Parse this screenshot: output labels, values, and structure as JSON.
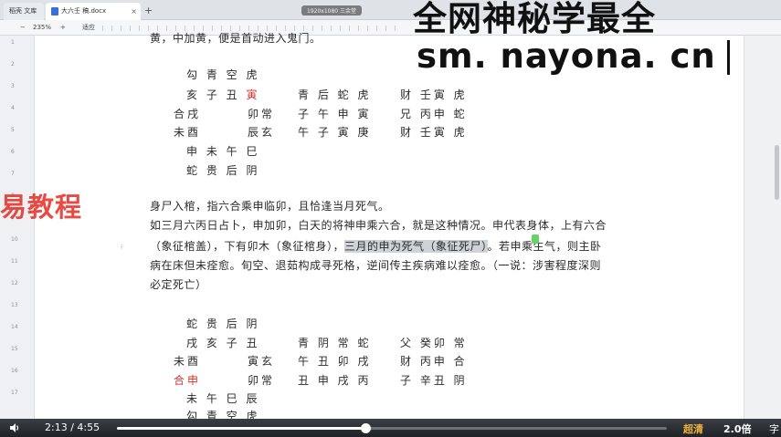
{
  "tabs": {
    "tab1_label": "稻壳 文库",
    "tab2_label": "大六壬 稿.docx",
    "new_tab": "+",
    "close": "×"
  },
  "sysinfo": "1920x1080  三余堂",
  "toolbar": {
    "zoom_minus": "−",
    "zoom_value": "235%",
    "zoom_plus": "+",
    "fit": "适应"
  },
  "line_numbers": [
    "1",
    "2",
    "3",
    "4",
    "5",
    "6",
    "7",
    "8",
    "9",
    "10",
    "11",
    "12",
    "13",
    "14",
    "15",
    "16",
    "17"
  ],
  "document": {
    "top_line": "黄，中加黄，便是首动进入鬼门。",
    "chart1": {
      "row1": "勾 青 空 虎",
      "row2_pre": "亥 子 丑 ",
      "row2_red": "寅",
      "row2_mid": "青 后 蛇 虎",
      "row2_right": "财 壬寅 虎",
      "row3_left": "合戌",
      "row3_mid1": "卯常",
      "row3_mid2": "子 午 申 寅",
      "row3_right": "兄 丙申 蛇",
      "row4_left": "未酉",
      "row4_mid1": "辰玄",
      "row4_mid2": "午 子 寅 庚",
      "row4_right": "财 壬寅 虎",
      "row5": "申 未 午 巳",
      "row6": "蛇 贵 后 阴"
    },
    "para1": "身尸入棺，指六合乘申临卯，且恰逢当月死气。",
    "para2": "如三月六丙日占卜，申加卯，白天的将神申乘六合，就是这种情况。申代表身体，上有六合",
    "para3_pre": "（象征棺盖），下有卯木（象征棺身），",
    "para3_hl": "三月的申为死气（象征死尸）",
    "para3_post": "。若申乘生气，则主卧",
    "para4": "病在床但未痊愈。旬空、退茹构成寻死格，逆间传主疾病难以痊愈。（一说：涉害程度深则",
    "para5": "必定死亡）",
    "chart2": {
      "row1": "蛇 贵 后 阴",
      "row2": "戌 亥 子 丑",
      "row2_mid": "青 阴 常 蛇",
      "row2_right": "父 癸卯 常",
      "row3_left": "未酉",
      "row3_mid1": "寅玄",
      "row3_mid2": "午 丑 卯 戌",
      "row3_right": "财 丙申 合",
      "row4_left": "合申",
      "row4_mid1": "卯常",
      "row4_mid2": "丑 申 戌 丙",
      "row4_right": "子 辛丑 阴",
      "row5": "未 午 巳 辰",
      "row6": "勾 青 空 虎"
    }
  },
  "watermarks": {
    "left": "易教程",
    "top": "全网神秘学最全",
    "url": "sm. nayona. cn"
  },
  "player": {
    "current_time": "2:13",
    "separator": " / ",
    "duration": "4:55",
    "progress": 0.451,
    "quality": "超清",
    "speed": "2.0倍",
    "subtitles": "字"
  },
  "colors": {
    "accent_red": "#d4322c",
    "quality_orange": "#f0b23a",
    "highlight_gray": "#cfd2d6"
  }
}
